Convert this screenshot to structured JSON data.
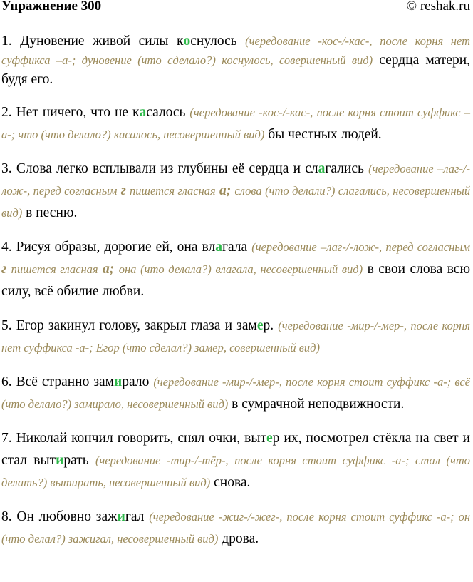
{
  "header": {
    "title": "Упражнение 300",
    "site": "© reshak.ru"
  },
  "items": [
    {
      "num": "1.",
      "pre": "Дуновение живой силы к",
      "hl": "о",
      "post": "снулось",
      "note": "(чередование -кос-/-кас-, после корня нет суффикса –а-; дуновение (что сделало?) коснулось, совершенный вид)",
      "tail": "сердца матери, будя его."
    },
    {
      "num": "2.",
      "pre": "Нет ничего, что не к",
      "hl": "а",
      "post": "салось",
      "note": "(чередование -кос-/-кас-, после корня стоит суффикс –а-; что (что делало?) касалось, несовершенный вид)",
      "tail": "бы честных людей."
    },
    {
      "num": "3.",
      "pre": "Слова легко всплывали из глубины её сердца и сл",
      "hl": "а",
      "post": "гались",
      "note_a": "(чередование –лаг-/-лож-, перед согласным",
      "note_b": "г",
      "note_c": "пишется гласная",
      "note_d": "а;",
      "note_e": "слова (что делали?) слагались, несовершенный вид)",
      "tail": "в песню."
    },
    {
      "num": "4.",
      "pre": "Рисуя образы, дорогие ей, она вл",
      "hl": "а",
      "post": "гала",
      "note_a": "(чередование –лаг-/-лож-, перед согласным",
      "note_b": "г",
      "note_c": "пишется гласная",
      "note_d": "а;",
      "note_e": "она (что делала?) влагала, несовершенный вид)",
      "tail": "в свои слова всю силу, всё обилие любви."
    },
    {
      "num": "5.",
      "pre": "Егор закинул голову, закрыл глаза и зам",
      "hl": "е",
      "post": "р.",
      "note": "(чередование -мир-/-мер-, после корня нет суффикса -а-; Егор (что сделал?) замер, совершенный вид)",
      "tail": ""
    },
    {
      "num": "6.",
      "pre": "Всё странно зам",
      "hl": "и",
      "post": "рало",
      "note": "(чередование -мир-/-мер-, после корня стоит суффикс -а-; всё (что делало?) замирало, несовершенный вид)",
      "tail": "в сумрачной неподвижности."
    },
    {
      "num": "7.",
      "pre": "Николай кончил говорить, снял очки, выт",
      "hl": "е",
      "post": "р их, посмотрел стёкла на свет и стал выт",
      "hl2": "и",
      "post2": "рать",
      "note": "(чередование -тир-/-тёр-, после корня стоит суффикс -а-; стал (что делать?) вытирать, несовершенный вид)",
      "tail": "снова."
    },
    {
      "num": "8.",
      "pre": "Он любовно заж",
      "hl": "и",
      "post": "гал",
      "note": "(чередование -жиг-/-жег-, после корня стоит суффикс -а-; он (что делал?) зажигал, несовершенный вид)",
      "tail": "дрова."
    }
  ],
  "colors": {
    "highlight": "#2eb84a",
    "note": "#9b8a5a",
    "text": "#000000"
  }
}
